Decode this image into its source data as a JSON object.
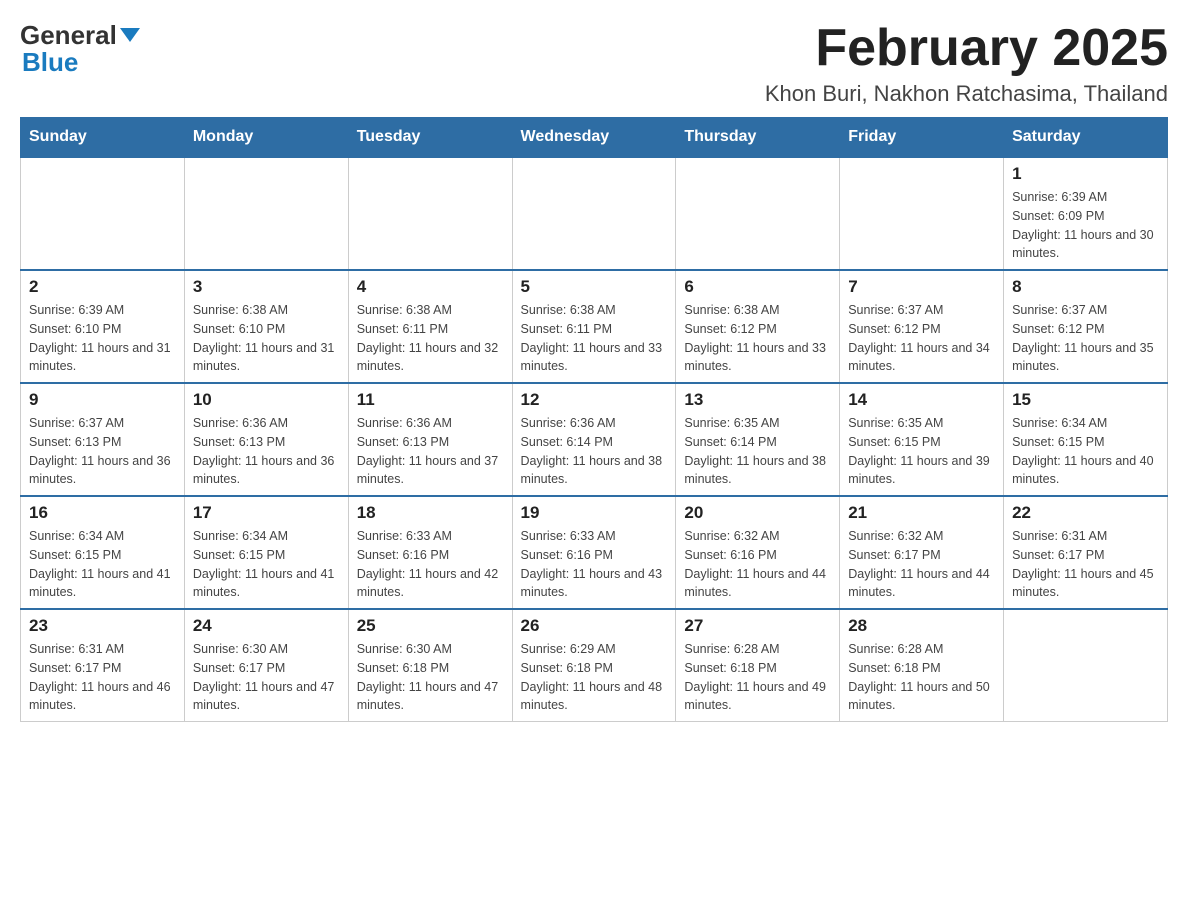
{
  "logo": {
    "general": "General",
    "blue": "Blue"
  },
  "header": {
    "month_year": "February 2025",
    "location": "Khon Buri, Nakhon Ratchasima, Thailand"
  },
  "weekdays": [
    "Sunday",
    "Monday",
    "Tuesday",
    "Wednesday",
    "Thursday",
    "Friday",
    "Saturday"
  ],
  "weeks": [
    [
      {
        "day": "",
        "info": ""
      },
      {
        "day": "",
        "info": ""
      },
      {
        "day": "",
        "info": ""
      },
      {
        "day": "",
        "info": ""
      },
      {
        "day": "",
        "info": ""
      },
      {
        "day": "",
        "info": ""
      },
      {
        "day": "1",
        "info": "Sunrise: 6:39 AM\nSunset: 6:09 PM\nDaylight: 11 hours and 30 minutes."
      }
    ],
    [
      {
        "day": "2",
        "info": "Sunrise: 6:39 AM\nSunset: 6:10 PM\nDaylight: 11 hours and 31 minutes."
      },
      {
        "day": "3",
        "info": "Sunrise: 6:38 AM\nSunset: 6:10 PM\nDaylight: 11 hours and 31 minutes."
      },
      {
        "day": "4",
        "info": "Sunrise: 6:38 AM\nSunset: 6:11 PM\nDaylight: 11 hours and 32 minutes."
      },
      {
        "day": "5",
        "info": "Sunrise: 6:38 AM\nSunset: 6:11 PM\nDaylight: 11 hours and 33 minutes."
      },
      {
        "day": "6",
        "info": "Sunrise: 6:38 AM\nSunset: 6:12 PM\nDaylight: 11 hours and 33 minutes."
      },
      {
        "day": "7",
        "info": "Sunrise: 6:37 AM\nSunset: 6:12 PM\nDaylight: 11 hours and 34 minutes."
      },
      {
        "day": "8",
        "info": "Sunrise: 6:37 AM\nSunset: 6:12 PM\nDaylight: 11 hours and 35 minutes."
      }
    ],
    [
      {
        "day": "9",
        "info": "Sunrise: 6:37 AM\nSunset: 6:13 PM\nDaylight: 11 hours and 36 minutes."
      },
      {
        "day": "10",
        "info": "Sunrise: 6:36 AM\nSunset: 6:13 PM\nDaylight: 11 hours and 36 minutes."
      },
      {
        "day": "11",
        "info": "Sunrise: 6:36 AM\nSunset: 6:13 PM\nDaylight: 11 hours and 37 minutes."
      },
      {
        "day": "12",
        "info": "Sunrise: 6:36 AM\nSunset: 6:14 PM\nDaylight: 11 hours and 38 minutes."
      },
      {
        "day": "13",
        "info": "Sunrise: 6:35 AM\nSunset: 6:14 PM\nDaylight: 11 hours and 38 minutes."
      },
      {
        "day": "14",
        "info": "Sunrise: 6:35 AM\nSunset: 6:15 PM\nDaylight: 11 hours and 39 minutes."
      },
      {
        "day": "15",
        "info": "Sunrise: 6:34 AM\nSunset: 6:15 PM\nDaylight: 11 hours and 40 minutes."
      }
    ],
    [
      {
        "day": "16",
        "info": "Sunrise: 6:34 AM\nSunset: 6:15 PM\nDaylight: 11 hours and 41 minutes."
      },
      {
        "day": "17",
        "info": "Sunrise: 6:34 AM\nSunset: 6:15 PM\nDaylight: 11 hours and 41 minutes."
      },
      {
        "day": "18",
        "info": "Sunrise: 6:33 AM\nSunset: 6:16 PM\nDaylight: 11 hours and 42 minutes."
      },
      {
        "day": "19",
        "info": "Sunrise: 6:33 AM\nSunset: 6:16 PM\nDaylight: 11 hours and 43 minutes."
      },
      {
        "day": "20",
        "info": "Sunrise: 6:32 AM\nSunset: 6:16 PM\nDaylight: 11 hours and 44 minutes."
      },
      {
        "day": "21",
        "info": "Sunrise: 6:32 AM\nSunset: 6:17 PM\nDaylight: 11 hours and 44 minutes."
      },
      {
        "day": "22",
        "info": "Sunrise: 6:31 AM\nSunset: 6:17 PM\nDaylight: 11 hours and 45 minutes."
      }
    ],
    [
      {
        "day": "23",
        "info": "Sunrise: 6:31 AM\nSunset: 6:17 PM\nDaylight: 11 hours and 46 minutes."
      },
      {
        "day": "24",
        "info": "Sunrise: 6:30 AM\nSunset: 6:17 PM\nDaylight: 11 hours and 47 minutes."
      },
      {
        "day": "25",
        "info": "Sunrise: 6:30 AM\nSunset: 6:18 PM\nDaylight: 11 hours and 47 minutes."
      },
      {
        "day": "26",
        "info": "Sunrise: 6:29 AM\nSunset: 6:18 PM\nDaylight: 11 hours and 48 minutes."
      },
      {
        "day": "27",
        "info": "Sunrise: 6:28 AM\nSunset: 6:18 PM\nDaylight: 11 hours and 49 minutes."
      },
      {
        "day": "28",
        "info": "Sunrise: 6:28 AM\nSunset: 6:18 PM\nDaylight: 11 hours and 50 minutes."
      },
      {
        "day": "",
        "info": ""
      }
    ]
  ]
}
